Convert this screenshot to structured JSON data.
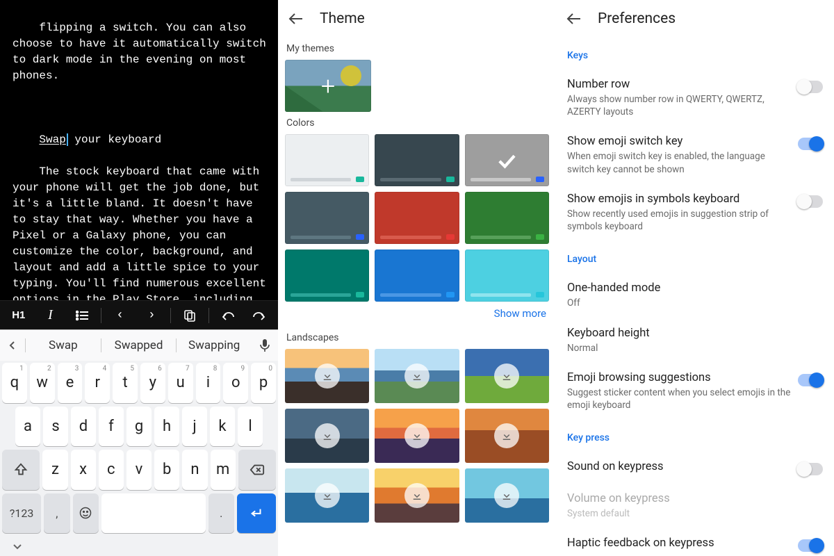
{
  "editor": {
    "truncated_top": "flipping a switch. You can also choose to have it automatically switch to dark mode in the evening on most phones.",
    "heading_underlined": "Swap",
    "heading_rest": " your keyboard",
    "body": "The stock keyboard that came with your phone will get the job done, but it's a little bland. It doesn't have to stay that way. Whether you have a Pixel or a Galaxy phone, you can customize the color, background, and layout and add a little spice to your typing. You'll find numerous excellent options in the Play Store, including Google's Gboard (if you don't already have a Pixel), Swiftkey, and the extremely popular Go Keyboard, which lets you customize to your heart's content.",
    "toolbar": {
      "h1": "H1",
      "italic": "I",
      "list": "≡",
      "left": "‹",
      "right": "›",
      "copy": "⧉",
      "undo": "↶",
      "redo": "↷"
    }
  },
  "keyboard": {
    "suggestions": [
      "Swap",
      "Swapped",
      "Swapping"
    ],
    "row1": [
      {
        "k": "q",
        "h": "1"
      },
      {
        "k": "w",
        "h": "2"
      },
      {
        "k": "e",
        "h": "3"
      },
      {
        "k": "r",
        "h": "4"
      },
      {
        "k": "t",
        "h": "5"
      },
      {
        "k": "y",
        "h": "6"
      },
      {
        "k": "u",
        "h": "7"
      },
      {
        "k": "i",
        "h": "8"
      },
      {
        "k": "o",
        "h": "9"
      },
      {
        "k": "p",
        "h": "0"
      }
    ],
    "row2": [
      "a",
      "s",
      "d",
      "f",
      "g",
      "h",
      "j",
      "k",
      "l"
    ],
    "row3": [
      "z",
      "x",
      "c",
      "v",
      "b",
      "n",
      "m"
    ],
    "symkey": "?123",
    "comma": ",",
    "period": "."
  },
  "theme": {
    "title": "Theme",
    "section_my": "My themes",
    "section_colors": "Colors",
    "colors": [
      {
        "bg": "#eceff1",
        "strip": "#cfd4d8",
        "chip": "#19b89c",
        "selected": false
      },
      {
        "bg": "#37474f",
        "strip": "#5a6a72",
        "chip": "#19b89c",
        "selected": false
      },
      {
        "bg": "#9e9e9e",
        "strip": "#c8c8c8",
        "chip": "#2962ff",
        "selected": true
      },
      {
        "bg": "#455a64",
        "strip": "#5e7781",
        "chip": "#2962ff",
        "selected": false
      },
      {
        "bg": "#c0392b",
        "strip": "#d85a4c",
        "chip": "#e53935",
        "selected": false
      },
      {
        "bg": "#2e7d32",
        "strip": "#57a05a",
        "chip": "#3bb143",
        "selected": false
      },
      {
        "bg": "#00796b",
        "strip": "#2aa598",
        "chip": "#19b89c",
        "selected": false
      },
      {
        "bg": "#1976d2",
        "strip": "#4a97e4",
        "chip": "#2196f3",
        "selected": false
      },
      {
        "bg": "#4dd0e1",
        "strip": "#8fe4ee",
        "chip": "#26c6da",
        "selected": false
      }
    ],
    "show_more": "Show more",
    "section_landscapes": "Landscapes",
    "landscapes": [
      "linear-gradient(#f7c27a 0 35%,#5b8bb5 35% 60%,#3a2f2a 60% 100%)",
      "linear-gradient(#b9dff5 0 40%,#4a7da8 40% 60%,#5a8a54 60% 100%)",
      "linear-gradient(#3b6fb0 0 50%,#6faa3c 50% 100%)",
      "linear-gradient(#4b6a84 0 55%,#2a3b4a 55% 100%)",
      "linear-gradient(#f6a14a 0 35%,#e06b3f 35% 55%,#3a2a55 55% 100%)",
      "linear-gradient(#e0873f 0 40%,#9a4d25 40% 100%)",
      "linear-gradient(#c8e6ef 0 45%,#2a6fa0 45% 100%)",
      "linear-gradient(#f8d16a 0 35%,#e07a2f 35% 65%,#5a3d3d 65% 100%)",
      "linear-gradient(#72c7e0 0 55%,#2a6fa0 55% 100%)"
    ]
  },
  "prefs": {
    "title": "Preferences",
    "sections": {
      "keys": "Keys",
      "layout": "Layout",
      "keypress": "Key press"
    },
    "items": {
      "number_row": {
        "title": "Number row",
        "sub": "Always show number row in QWERTY, QWERTZ, AZERTY layouts",
        "on": false
      },
      "emoji_switch": {
        "title": "Show emoji switch key",
        "sub": "When emoji switch key is enabled, the language switch key cannot be shown",
        "on": true
      },
      "emoji_symbols": {
        "title": "Show emojis in symbols keyboard",
        "sub": "Show recently used emojis in suggestion strip of symbols keyboard",
        "on": false
      },
      "one_handed": {
        "title": "One-handed mode",
        "sub": "Off"
      },
      "kb_height": {
        "title": "Keyboard height",
        "sub": "Normal"
      },
      "emoji_browse": {
        "title": "Emoji browsing suggestions",
        "sub": "Suggest sticker content when you select emojis in the emoji keyboard",
        "on": true
      },
      "sound": {
        "title": "Sound on keypress",
        "sub": "",
        "on": false
      },
      "volume": {
        "title": "Volume on keypress",
        "sub": "System default",
        "disabled": true
      },
      "haptic": {
        "title": "Haptic feedback on keypress",
        "sub": "",
        "on": true
      }
    }
  }
}
